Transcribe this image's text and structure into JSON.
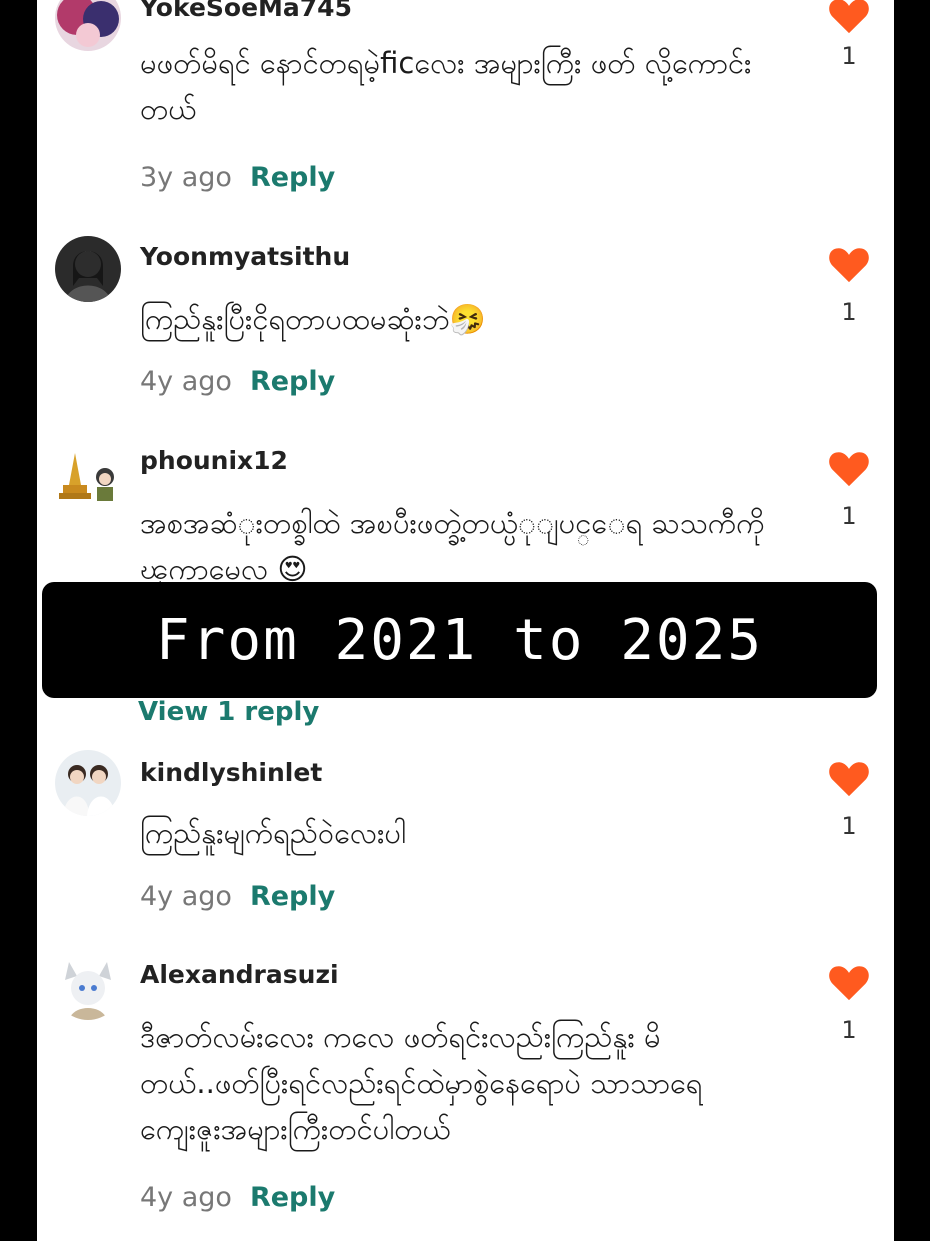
{
  "comments": [
    {
      "username": "YokeSoeMa745",
      "text": "မဖတ်မိရင် နောင်တရမဲ့ficလေး အများကြီး ဖတ် လို့ကောင်းတယ်",
      "time": "3y ago",
      "reply_label": "Reply",
      "likes": "1"
    },
    {
      "username": "Yoonmyatsithu",
      "text": "ကြည်နူးပြီးငိုရတာပထမဆုံးဘဲ🤧",
      "time": "4y ago",
      "reply_label": "Reply",
      "likes": "1"
    },
    {
      "username": "phounix12",
      "text": "အစအဆံုးတစ္ခါထဲ အၿပီးဖတ္ခဲ့တယ္ပံုျပင္ေရ ႀသကီကိုၾကာမေလ 😍",
      "likes": "1",
      "view_replies": "View 1 reply"
    },
    {
      "username": "kindlyshinlet",
      "text": "ကြည်နူးမျက်ရည်ဝဲလေးပါ",
      "time": "4y ago",
      "reply_label": "Reply",
      "likes": "1"
    },
    {
      "username": "Alexandrasuzi",
      "text": "ဒီဇာတ်လမ်းလေး ကလေ ဖတ်ရင်းလည်းကြည်နူး မိတယ်..ဖတ်ပြီးရင်လည်းရင်ထဲမှာစွဲနေရောပဲ သာသာရေ ကျေးဇူးအများကြီးတင်ပါတယ်",
      "time": "4y ago",
      "reply_label": "Reply",
      "likes": "1"
    }
  ],
  "overlay_caption": "From 2021 to 2025",
  "colors": {
    "heart": "#ff5a1f",
    "reply": "#1b7a6e",
    "banner_bg": "#000000"
  }
}
